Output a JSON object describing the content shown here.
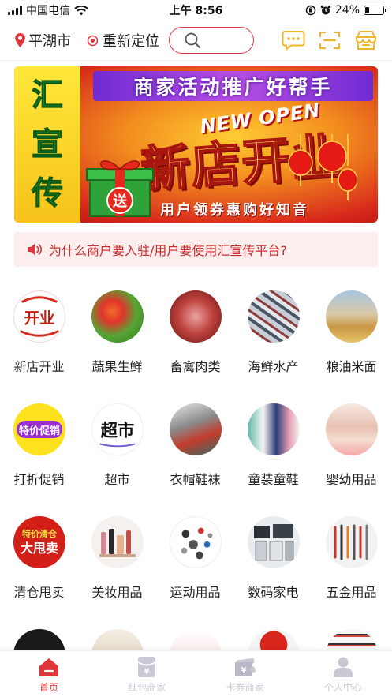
{
  "status_bar": {
    "carrier": "中国电信",
    "time": "上午 8:56",
    "battery_text": "24%",
    "battery_level": 0.24
  },
  "top_bar": {
    "city": "平湖市",
    "relocate_label": "重新定位",
    "icons": [
      "message-icon",
      "scan-icon",
      "shop-icon"
    ]
  },
  "banner": {
    "side_text": [
      "汇",
      "宣",
      "传"
    ],
    "headline": "商家活动推广好帮手",
    "tag": "NEW OPEN",
    "big_text": "新店开业",
    "footer": "用户领券惠购好知音",
    "badge": "送"
  },
  "notice": {
    "icon": "speaker-icon",
    "text": "为什么商户要入驻/用户要使用汇宣传平台?"
  },
  "categories": [
    {
      "label": "新店开业",
      "thumb": "开业"
    },
    {
      "label": "蔬果生鲜"
    },
    {
      "label": "畜禽肉类"
    },
    {
      "label": "海鲜水产"
    },
    {
      "label": "粮油米面"
    },
    {
      "label": "打折促销",
      "thumb": "特价促销"
    },
    {
      "label": "超市",
      "thumb": "超市"
    },
    {
      "label": "衣帽鞋袜"
    },
    {
      "label": "童装童鞋"
    },
    {
      "label": "婴幼用品"
    },
    {
      "label": "清仓甩卖",
      "thumb": [
        "特价清仓",
        "大甩卖"
      ]
    },
    {
      "label": "美妆用品"
    },
    {
      "label": "运动用品"
    },
    {
      "label": "数码家电"
    },
    {
      "label": "五金用品"
    }
  ],
  "tabs": [
    {
      "label": "首页",
      "icon": "home-icon",
      "active": true
    },
    {
      "label": "红包商家",
      "icon": "red-packet-icon",
      "active": false
    },
    {
      "label": "卡券商家",
      "icon": "coupon-icon",
      "active": false
    },
    {
      "label": "个人中心",
      "icon": "user-icon",
      "active": false
    }
  ],
  "colors": {
    "accent": "#e0353a",
    "notice_bg": "#fdeeee",
    "icon_gold": "#f0b528",
    "tab_inactive": "#c9c9d6"
  }
}
